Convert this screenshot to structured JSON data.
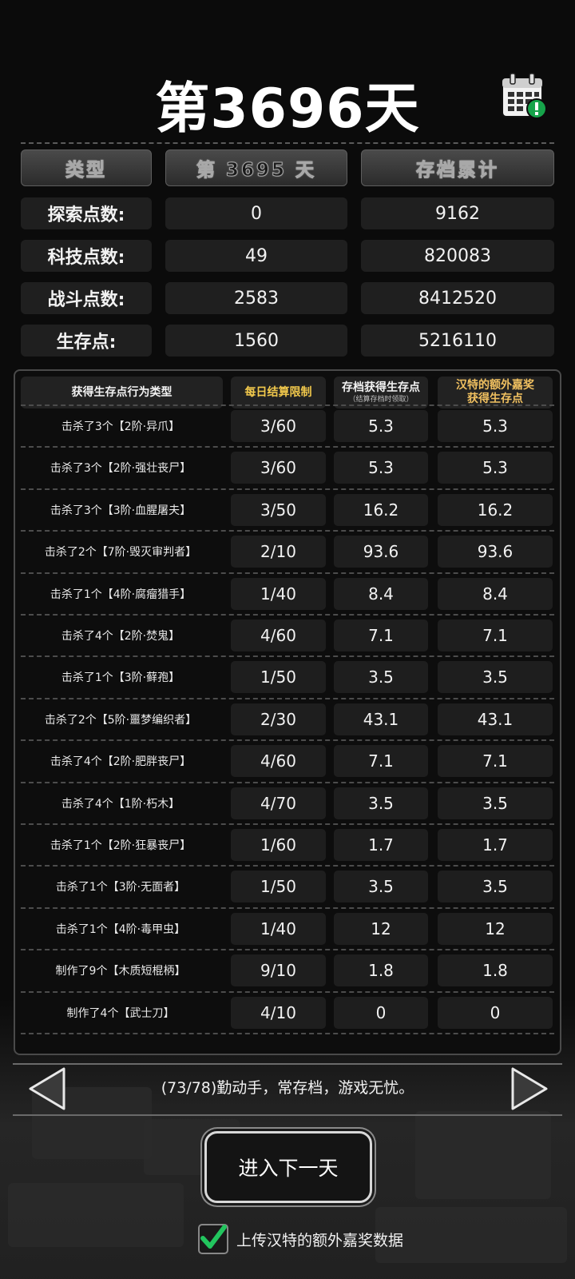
{
  "title": "第3696天",
  "icons": {
    "calendar": "calendar-alert-icon",
    "prev": "arrow-left-icon",
    "next": "arrow-right-icon",
    "check": "check-icon"
  },
  "colors": {
    "accent_gold": "#f2c94c",
    "check_green": "#22c55e",
    "alert_green": "#16a34a"
  },
  "summary": {
    "headers": [
      "类型",
      "第 3695 天",
      "存档累计"
    ],
    "rows": [
      {
        "label": "探索点数:",
        "day": "0",
        "total": "9162"
      },
      {
        "label": "科技点数:",
        "day": "49",
        "total": "820083"
      },
      {
        "label": "战斗点数:",
        "day": "2583",
        "total": "8412520"
      },
      {
        "label": "生存点:",
        "day": "1560",
        "total": "5216110"
      }
    ]
  },
  "detail": {
    "headers": {
      "type": "获得生存点行为类型",
      "limit": "每日结算限制",
      "save_points": "存档获得生存点",
      "save_points_note": "（结算存档时领取）",
      "hunter_bonus_line1": "汉特的额外嘉奖",
      "hunter_bonus_line2": "获得生存点"
    },
    "rows": [
      {
        "action": "击杀了3个【2阶·异爪】",
        "limit": "3/60",
        "save": "5.3",
        "bonus": "5.3"
      },
      {
        "action": "击杀了3个【2阶·强壮丧尸】",
        "limit": "3/60",
        "save": "5.3",
        "bonus": "5.3"
      },
      {
        "action": "击杀了3个【3阶·血腥屠夫】",
        "limit": "3/50",
        "save": "16.2",
        "bonus": "16.2"
      },
      {
        "action": "击杀了2个【7阶·毁灭审判者】",
        "limit": "2/10",
        "save": "93.6",
        "bonus": "93.6"
      },
      {
        "action": "击杀了1个【4阶·腐瘤猎手】",
        "limit": "1/40",
        "save": "8.4",
        "bonus": "8.4"
      },
      {
        "action": "击杀了4个【2阶·焚鬼】",
        "limit": "4/60",
        "save": "7.1",
        "bonus": "7.1"
      },
      {
        "action": "击杀了1个【3阶·藓孢】",
        "limit": "1/50",
        "save": "3.5",
        "bonus": "3.5"
      },
      {
        "action": "击杀了2个【5阶·噩梦编织者】",
        "limit": "2/30",
        "save": "43.1",
        "bonus": "43.1"
      },
      {
        "action": "击杀了4个【2阶·肥胖丧尸】",
        "limit": "4/60",
        "save": "7.1",
        "bonus": "7.1"
      },
      {
        "action": "击杀了4个【1阶·朽木】",
        "limit": "4/70",
        "save": "3.5",
        "bonus": "3.5"
      },
      {
        "action": "击杀了1个【2阶·狂暴丧尸】",
        "limit": "1/60",
        "save": "1.7",
        "bonus": "1.7"
      },
      {
        "action": "击杀了1个【3阶·无面者】",
        "limit": "1/50",
        "save": "3.5",
        "bonus": "3.5"
      },
      {
        "action": "击杀了1个【4阶·毒甲虫】",
        "limit": "1/40",
        "save": "12",
        "bonus": "12"
      },
      {
        "action": "制作了9个【木质短棍柄】",
        "limit": "9/10",
        "save": "1.8",
        "bonus": "1.8"
      },
      {
        "action": "制作了4个【武士刀】",
        "limit": "4/10",
        "save": "0",
        "bonus": "0"
      }
    ]
  },
  "tip": "(73/78)勤动手，常存档，游戏无忧。",
  "next_day_button": "进入下一天",
  "upload_checkbox": {
    "label": "上传汉特的额外嘉奖数据",
    "checked": true
  }
}
